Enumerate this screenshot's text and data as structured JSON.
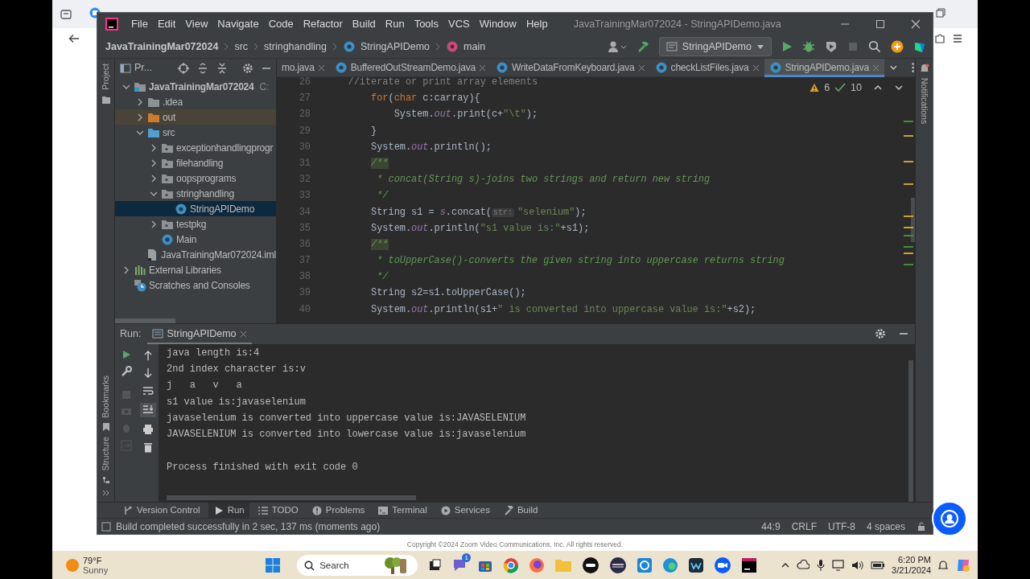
{
  "ide": {
    "menu": [
      "File",
      "Edit",
      "View",
      "Navigate",
      "Code",
      "Refactor",
      "Build",
      "Run",
      "Tools",
      "VCS",
      "Window",
      "Help"
    ],
    "title": "JavaTrainingMar072024 - StringAPIDemo.java",
    "breadcrumb": [
      {
        "label": "JavaTrainingMar072024",
        "kind": "project"
      },
      {
        "label": "src",
        "kind": "folder"
      },
      {
        "label": "stringhandling",
        "kind": "folder"
      },
      {
        "label": "StringAPIDemo",
        "kind": "class"
      },
      {
        "label": "main",
        "kind": "method"
      }
    ],
    "run_configuration": "StringAPIDemo",
    "left_strip": {
      "top": "Project",
      "bottom": [
        "Bookmarks",
        "Structure"
      ]
    },
    "right_strip": "Notifications",
    "project_panel": {
      "title": "Pr...",
      "tree": [
        {
          "label": "JavaTrainingMar072024",
          "path": "C:",
          "kind": "project",
          "expanded": true,
          "selected": false,
          "children": [
            {
              "label": ".idea",
              "kind": "folder",
              "expanded": false,
              "selected": false
            },
            {
              "label": "out",
              "kind": "excluded",
              "expanded": false,
              "selected": false
            },
            {
              "label": "src",
              "kind": "source",
              "expanded": true,
              "selected": false,
              "children": [
                {
                  "label": "exceptionhandlingprogr",
                  "kind": "package",
                  "expanded": false,
                  "selected": false
                },
                {
                  "label": "filehandling",
                  "kind": "package",
                  "expanded": false,
                  "selected": false
                },
                {
                  "label": "oopsprograms",
                  "kind": "package",
                  "expanded": false,
                  "selected": false
                },
                {
                  "label": "stringhandling",
                  "kind": "package",
                  "expanded": true,
                  "selected": false,
                  "children": [
                    {
                      "label": "StringAPIDemo",
                      "kind": "class",
                      "selected": true
                    }
                  ]
                },
                {
                  "label": "testpkg",
                  "kind": "package",
                  "expanded": false,
                  "selected": false
                },
                {
                  "label": "Main",
                  "kind": "class",
                  "selected": false
                }
              ]
            },
            {
              "label": "JavaTrainingMar072024.iml",
              "kind": "file",
              "selected": false
            }
          ]
        },
        {
          "label": "External Libraries",
          "kind": "libraries",
          "expanded": false,
          "selected": false
        },
        {
          "label": "Scratches and Consoles",
          "kind": "scratches",
          "selected": false
        }
      ]
    },
    "editor_tabs": [
      {
        "label": "mo.java",
        "kind": "partial",
        "selected": false
      },
      {
        "label": "BufferedOutStreamDemo.java",
        "kind": "class",
        "selected": false
      },
      {
        "label": "WriteDataFromKeyboard.java",
        "kind": "class",
        "selected": false
      },
      {
        "label": "checkListFiles.java",
        "kind": "class",
        "selected": false
      },
      {
        "label": "StringAPIDemo.java",
        "kind": "class",
        "selected": true
      }
    ],
    "inspections": {
      "warnings": "6",
      "passed": "10"
    },
    "code": [
      {
        "number": "26",
        "segments": [
          {
            "kind": "comment",
            "text": "    //iterate or print array elements"
          }
        ]
      },
      {
        "number": "27",
        "segments": [
          {
            "kind": "keyword",
            "text": "        for"
          },
          {
            "kind": "plain",
            "text": "("
          },
          {
            "kind": "keyword",
            "text": "char"
          },
          {
            "kind": "plain",
            "text": " c:carray){"
          }
        ]
      },
      {
        "number": "28",
        "segments": [
          {
            "kind": "plain",
            "text": "            System."
          },
          {
            "kind": "field",
            "text": "out"
          },
          {
            "kind": "plain",
            "text": ".print(c+"
          },
          {
            "kind": "string",
            "text": "\"\\t\""
          },
          {
            "kind": "plain",
            "text": ");"
          }
        ]
      },
      {
        "number": "29",
        "segments": [
          {
            "kind": "plain",
            "text": "        }"
          }
        ]
      },
      {
        "number": "30",
        "segments": [
          {
            "kind": "plain",
            "text": "        System."
          },
          {
            "kind": "field",
            "text": "out"
          },
          {
            "kind": "plain",
            "text": ".println();"
          }
        ]
      },
      {
        "number": "31",
        "segments": [
          {
            "kind": "marked",
            "text": "        /**"
          }
        ]
      },
      {
        "number": "32",
        "segments": [
          {
            "kind": "doc",
            "text": "         * concat(String s)-joins two strings and return new string"
          }
        ]
      },
      {
        "number": "33",
        "segments": [
          {
            "kind": "doc",
            "text": "         */"
          }
        ]
      },
      {
        "number": "34",
        "segments": [
          {
            "kind": "plain",
            "text": "        String s1 = "
          },
          {
            "kind": "field",
            "text": "s"
          },
          {
            "kind": "plain",
            "text": ".concat("
          },
          {
            "kind": "hint",
            "text": "str:"
          },
          {
            "kind": "string",
            "text": "\"selenium\""
          },
          {
            "kind": "plain",
            "text": ");"
          }
        ]
      },
      {
        "number": "35",
        "segments": [
          {
            "kind": "plain",
            "text": "        System."
          },
          {
            "kind": "field",
            "text": "out"
          },
          {
            "kind": "plain",
            "text": ".println("
          },
          {
            "kind": "string",
            "text": "\"s1 value is:\""
          },
          {
            "kind": "plain",
            "text": "+s1);"
          }
        ]
      },
      {
        "number": "36",
        "segments": [
          {
            "kind": "marked",
            "text": "        /**"
          }
        ]
      },
      {
        "number": "37",
        "segments": [
          {
            "kind": "doc",
            "text": "         * toUpperCase()-converts the given string into uppercase returns string"
          }
        ]
      },
      {
        "number": "38",
        "segments": [
          {
            "kind": "doc",
            "text": "         */"
          }
        ]
      },
      {
        "number": "39",
        "segments": [
          {
            "kind": "plain",
            "text": "        String s2=s1.toUpperCase();"
          }
        ]
      },
      {
        "number": "40",
        "segments": [
          {
            "kind": "plain",
            "text": "        System."
          },
          {
            "kind": "field",
            "text": "out"
          },
          {
            "kind": "plain",
            "text": ".println(s1+"
          },
          {
            "kind": "string",
            "text": "\" is converted into uppercase value is:\""
          },
          {
            "kind": "plain",
            "text": "+s2);"
          }
        ]
      }
    ],
    "run_panel": {
      "label": "Run:",
      "tab": "StringAPIDemo",
      "output": [
        "java length is:4",
        "2nd index character is:v",
        "j   a   v   a",
        "s1 value is:javaselenium",
        "javaselenium is converted into uppercase value is:JAVASELENIUM",
        "JAVASELENIUM is converted into lowercase value is:javaselenium"
      ],
      "exit_message": "Process finished with exit code 0"
    },
    "tool_tabs": [
      {
        "label": "Version Control",
        "kind": "vcs",
        "selected": false
      },
      {
        "label": "Run",
        "kind": "run",
        "selected": true
      },
      {
        "label": "TODO",
        "kind": "todo",
        "selected": false
      },
      {
        "label": "Problems",
        "kind": "problems",
        "selected": false
      },
      {
        "label": "Terminal",
        "kind": "terminal",
        "selected": false
      },
      {
        "label": "Services",
        "kind": "services",
        "selected": false
      },
      {
        "label": "Build",
        "kind": "build",
        "selected": false
      }
    ],
    "status_bar": {
      "message": "Build completed successfully in 2 sec, 137 ms (moments ago)",
      "position": "44:9",
      "line_separator": "CRLF",
      "encoding": "UTF-8",
      "indent": "4 spaces"
    }
  },
  "page_footer": "Copyright ©2024 Zoom Video Communications, Inc. All rights reserved.",
  "taskbar": {
    "temperature": "79°F",
    "condition": "Sunny",
    "search": {
      "placeholder": "Search"
    },
    "chat_badge": "1",
    "time": "6:20 PM",
    "date": "3/21/2024"
  }
}
